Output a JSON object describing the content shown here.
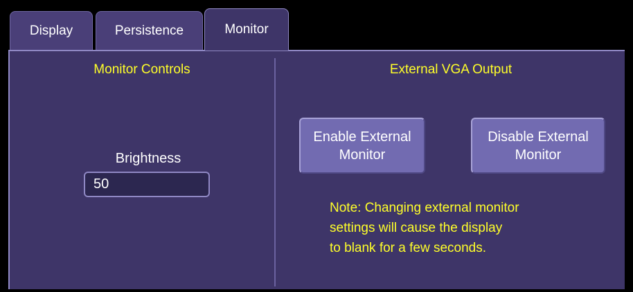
{
  "tabs": [
    {
      "label": "Display",
      "active": false
    },
    {
      "label": "Persistence",
      "active": false
    },
    {
      "label": "Monitor",
      "active": true
    }
  ],
  "monitor_controls": {
    "title": "Monitor Controls",
    "brightness_label": "Brightness",
    "brightness_value": "50"
  },
  "external_vga": {
    "title": "External VGA Output",
    "enable_button": "Enable External\nMonitor",
    "disable_button": "Disable External\nMonitor",
    "note": "Note: Changing external monitor\nsettings will cause the display\nto blank for a few seconds."
  },
  "colors": {
    "panel_bg": "#3e3568",
    "button_bg": "#726bb1",
    "title_text": "#ffff29",
    "label_text": "#ffffff",
    "field_bg": "#2c2750"
  }
}
